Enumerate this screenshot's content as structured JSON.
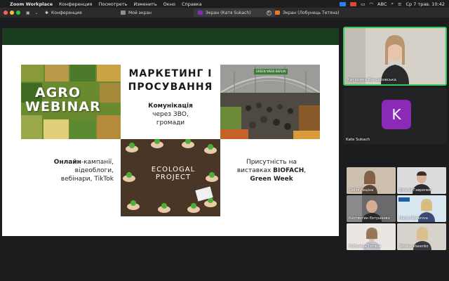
{
  "menubar": {
    "app": "Zoom Workplace",
    "items": [
      "Конференция",
      "Посмотреть",
      "Изменить",
      "Окно",
      "Справка"
    ],
    "input_lang": "ABC",
    "clock": "Ср 7 трав. 10:42"
  },
  "tabs": [
    {
      "label": "Конференция"
    },
    {
      "label": "Мой экран"
    },
    {
      "label": "Экран (Катя Sukach)"
    },
    {
      "label": "Экран (Лобунець Тетяна)"
    }
  ],
  "slide": {
    "agro_line1": "AGRO",
    "agro_line2": "WEBINAR",
    "title_line1": "МАРКЕТИНГ І",
    "title_line2": "ПРОСУВАННЯ",
    "sub_bold": "Комунікація",
    "sub_line2": "через ЗВО,",
    "sub_line3": "громади",
    "market_sign": "GREEN WEEK BERLIN",
    "eco_title1": "ECOLOGAL",
    "eco_title2": "PROJECT",
    "left_bold": "Онлайн",
    "left_l1": "-кампанії,",
    "left_l2": "відеоблоги,",
    "left_l3": "вебінари, TikTok",
    "right_l1": "Присутність на",
    "right_l2a": "виставках ",
    "right_l2b": "BIOFACH",
    "right_l2c": ",",
    "right_l3": "Green Week"
  },
  "participants": {
    "speaker": {
      "name": "Катерина Вансаровська"
    },
    "kate": {
      "initial": "K",
      "name": "Kate Sukach"
    },
    "grid": [
      {
        "name": "Софія Рещіна"
      },
      {
        "name": "Віталій Гаврилюк"
      },
      {
        "name": "Костянтин Євтушенко"
      },
      {
        "name": "Marja Nesterova"
      },
      {
        "name": "Лобунець Тетяна"
      },
      {
        "name": "Tetiana vlasenko"
      }
    ]
  },
  "colors": {
    "slide_dark_green": "#1a3d1f",
    "avatar_purple": "#8c2ab8",
    "active_speaker_border": "#35c759"
  }
}
